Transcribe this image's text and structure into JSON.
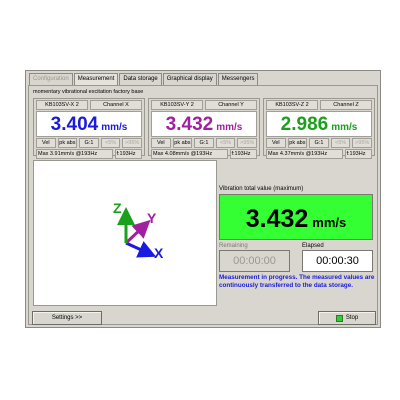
{
  "tabs": [
    "Configuration",
    "Measurement",
    "Data storage",
    "Graphical display",
    "Messengers"
  ],
  "subtitle": "momentary vibrational excitation factory  base",
  "channels": [
    {
      "sensor": "KB103SV-X 2",
      "channel": "Channel X",
      "value": "3.404",
      "unit": "mm/s",
      "mode": "Vel",
      "peak": "pk abs",
      "gain": "G:1",
      "f1": "<5%",
      "f2": ">95%",
      "max": "Max  3.91mm/s @193Hz",
      "freq": "f:193Hz"
    },
    {
      "sensor": "KB103SV-Y 2",
      "channel": "Channel Y",
      "value": "3.432",
      "unit": "mm/s",
      "mode": "Vel",
      "peak": "pk abs",
      "gain": "G:1",
      "f1": "<5%",
      "f2": ">95%",
      "max": "Max  4.08mm/s @193Hz",
      "freq": "f:193Hz"
    },
    {
      "sensor": "KB103SV-Z 2",
      "channel": "Channel Z",
      "value": "2.986",
      "unit": "mm/s",
      "mode": "Vel",
      "peak": "pk abs",
      "gain": "G:1",
      "f1": "<5%",
      "f2": ">95%",
      "max": "Max  4.37mm/s @193Hz",
      "freq": "f:193Hz"
    }
  ],
  "colors": {
    "channel_x": "#1a1ae0",
    "channel_y": "#a020a0",
    "channel_z": "#1aa01a",
    "total_bg": "#33ff33",
    "info": "#1a1ae0"
  },
  "axes": {
    "x": "X",
    "y": "Y",
    "z": "Z"
  },
  "total": {
    "label": "Vibration total value (maximum)",
    "value": "3.432",
    "unit": "mm/s"
  },
  "remaining": {
    "label": "Remaining",
    "value": "00:00:00"
  },
  "elapsed": {
    "label": "Elapsed",
    "value": "00:00:30"
  },
  "info": "Measurement in progress. The measured values are continuously transferred to the data storage.",
  "buttons": {
    "settings": "Settings >>",
    "stop": "Stop"
  }
}
